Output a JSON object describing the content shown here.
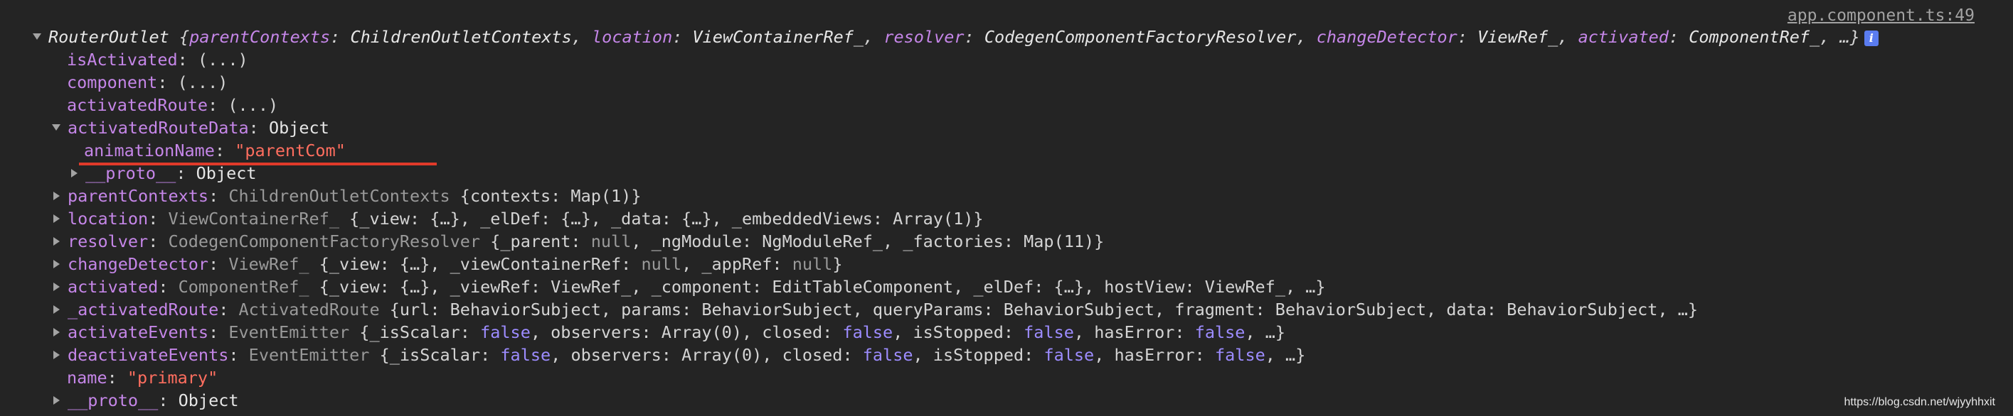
{
  "source_link": "app.component.ts:49",
  "root": {
    "name": "RouterOutlet",
    "summary_open": "{",
    "fields": [
      {
        "k": "parentContexts",
        "v": "ChildrenOutletContexts"
      },
      {
        "k": "location",
        "v": "ViewContainerRef_"
      },
      {
        "k": "resolver",
        "v": "CodegenComponentFactoryResolver"
      },
      {
        "k": "changeDetector",
        "v": "ViewRef_"
      },
      {
        "k": "activated",
        "v": "ComponentRef_"
      }
    ],
    "summary_close": "…}",
    "info_icon": "i"
  },
  "lines": {
    "isActivated": {
      "key": "isActivated",
      "val": "(...)"
    },
    "component": {
      "key": "component",
      "val": "(...)"
    },
    "activatedRoute": {
      "key": "activatedRoute",
      "val": "(...)"
    },
    "activatedRouteData": {
      "key": "activatedRouteData",
      "val": "Object"
    },
    "animationName": {
      "key": "animationName",
      "val": "parentCom"
    },
    "proto_inner": {
      "key": "__proto__",
      "val": "Object"
    },
    "parentContexts": {
      "key": "parentContexts",
      "type": "ChildrenOutletContexts",
      "rest": "{contexts: Map(1)}"
    },
    "location": {
      "key": "location",
      "type": "ViewContainerRef_",
      "rest": "{_view: {…}, _elDef: {…}, _data: {…}, _embeddedViews: Array(1)}"
    },
    "resolver": {
      "key": "resolver",
      "type": "CodegenComponentFactoryResolver",
      "rest_a": "{_parent:",
      "null": "null",
      "rest_b": ", _ngModule: NgModuleRef_, _factories: Map(11)}"
    },
    "changeDetector": {
      "key": "changeDetector",
      "type": "ViewRef_",
      "rest_a": "{_view: {…}, _viewContainerRef:",
      "null1": "null",
      "rest_b": ", _appRef:",
      "null2": "null",
      "rest_c": "}"
    },
    "activated": {
      "key": "activated",
      "type": "ComponentRef_",
      "rest": "{_view: {…}, _viewRef: ViewRef_, _component: EditTableComponent, _elDef: {…}, hostView: ViewRef_, …}"
    },
    "activatedRouteInternal": {
      "key": "_activatedRoute",
      "type": "ActivatedRoute",
      "rest": "{url: BehaviorSubject, params: BehaviorSubject, queryParams: BehaviorSubject, fragment: BehaviorSubject, data: BehaviorSubject, …}"
    },
    "activateEvents": {
      "key": "activateEvents",
      "type": "EventEmitter",
      "a": "{_isScalar:",
      "f1": "false",
      "b": ", observers: Array(0), closed:",
      "f2": "false",
      "c": ", isStopped:",
      "f3": "false",
      "d": ", hasError:",
      "f4": "false",
      "e": ", …}"
    },
    "deactivateEvents": {
      "key": "deactivateEvents",
      "type": "EventEmitter",
      "a": "{_isScalar:",
      "f1": "false",
      "b": ", observers: Array(0), closed:",
      "f2": "false",
      "c": ", isStopped:",
      "f3": "false",
      "d": ", hasError:",
      "f4": "false",
      "e": ", …}"
    },
    "name": {
      "key": "name",
      "val": "primary"
    },
    "proto_outer": {
      "key": "__proto__",
      "val": "Object"
    }
  },
  "watermark": "https://blog.csdn.net/wjyyhhxit"
}
